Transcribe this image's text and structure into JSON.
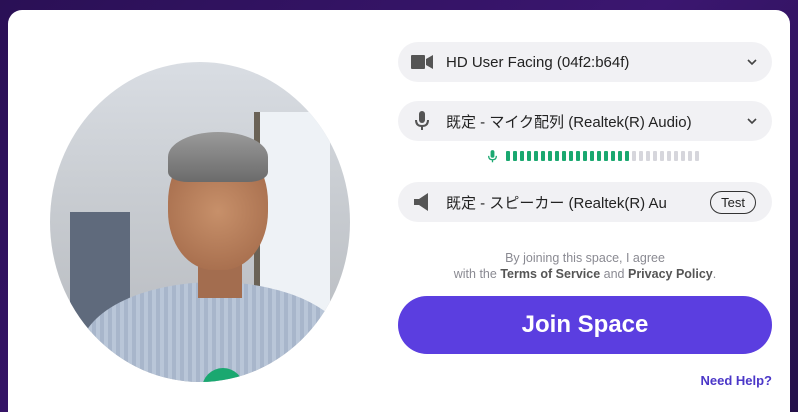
{
  "camera": {
    "device_label": "HD User Facing (04f2:b64f)"
  },
  "microphone": {
    "device_label": "既定 - マイク配列 (Realtek(R) Audio)",
    "level_fraction": 0.65
  },
  "speaker": {
    "device_label": "既定 - スピーカー (Realtek(R) Au",
    "test_label": "Test"
  },
  "terms": {
    "line1": "By joining this space, I agree",
    "prefix": "with the",
    "terms_link": "Terms of Service",
    "and": "and",
    "privacy_link": "Privacy Policy",
    "period": "."
  },
  "join_button": "Join Space",
  "help_link": "Need Help?",
  "colors": {
    "accent": "#5b3ee0",
    "green": "#1aa870",
    "meter_active": "#1aa870",
    "meter_inactive": "#d6d6dc"
  }
}
